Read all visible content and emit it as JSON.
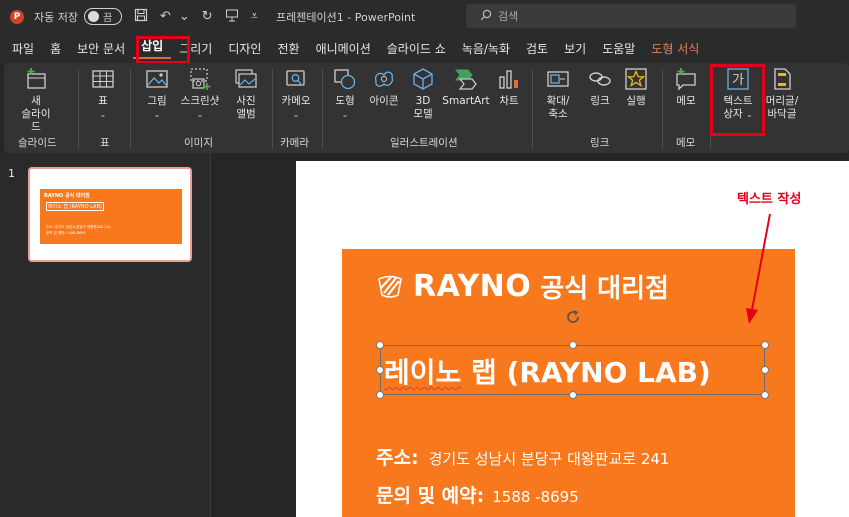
{
  "titlebar": {
    "app_icon": "P",
    "autosave_label": "자동 저장",
    "autosave_state": "끔",
    "doc_title": "프레젠테이션1 - PowerPoint",
    "search_placeholder": "검색",
    "icons": [
      "save-icon",
      "undo-icon",
      "redo-icon",
      "present-icon",
      "customize-icon"
    ]
  },
  "menu": {
    "tabs": [
      "파일",
      "홈",
      "보안 문서",
      "삽입",
      "그리기",
      "디자인",
      "전환",
      "애니메이션",
      "슬라이드 쇼",
      "녹음/녹화",
      "검토",
      "보기",
      "도움말",
      "도형 서식"
    ],
    "active": "삽입"
  },
  "ribbon": {
    "new_slide": [
      "새",
      "슬라이드"
    ],
    "table": "표",
    "picture": "그림",
    "screenshot": "스크린샷",
    "photo_album": [
      "사진",
      "앨범"
    ],
    "cameo": "카메오",
    "shapes": "도형",
    "icons": "아이콘",
    "models3d": [
      "3D",
      "모델"
    ],
    "smartart": "SmartArt",
    "chart": "차트",
    "zoom": [
      "확대/",
      "축소"
    ],
    "link": "링크",
    "action": "실행",
    "comment": "메모",
    "textbox": [
      "텍스트",
      "상자"
    ],
    "header_footer": [
      "머리글/",
      "바닥글"
    ],
    "textbox_glyph": "가",
    "groups": {
      "slides": "슬라이드",
      "table": "표",
      "images": "이미지",
      "camera": "카메라",
      "illustrations": "일러스트레이션",
      "links": "링크",
      "comments": "메모"
    }
  },
  "slides_panel": {
    "number": "1",
    "thumb_brand": "RAYNO 공식 대리점",
    "thumb_title": "레이노 랩 (RAYNO LAB)",
    "thumb_addr": "주소: 경기도 성남시 분당구 대왕판교로 241",
    "thumb_contact": "문의 및 예약: 1588-8695"
  },
  "slide": {
    "brand_name": "RAYNO",
    "brand_sub": "공식 대리점",
    "title_a": "레이노",
    "title_b": " 랩 (RAYNO LAB)",
    "addr_label": "주소:",
    "addr_value": "경기도 성남시 분당구 대왕판교로 241",
    "contact_label": "문의 및 예약:",
    "contact_value": "1588 -8695"
  },
  "annotation": {
    "text": "텍스트 작성",
    "color": "#e3001b"
  },
  "colors": {
    "accent_orange": "#f7781d",
    "highlight_red": "#e3001b"
  }
}
